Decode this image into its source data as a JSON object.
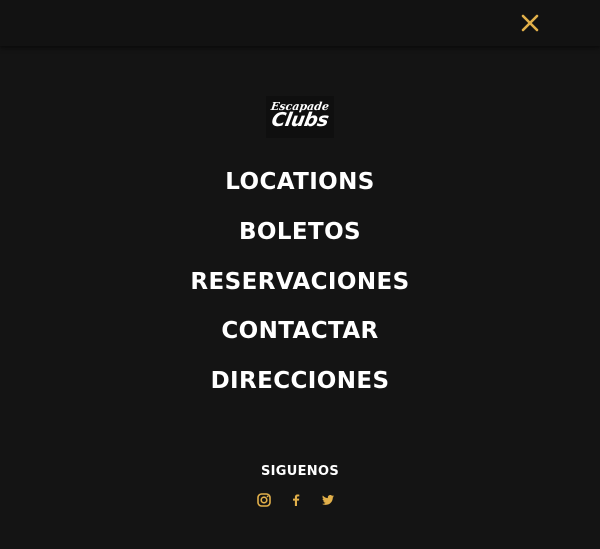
{
  "colors": {
    "background": "#141414",
    "topbar": "#121212",
    "accent": "#e2b04a",
    "text": "#ffffff"
  },
  "header": {
    "close_icon": "close-x-icon"
  },
  "logo": {
    "script_text": "Escapade",
    "brand_text": "Clubs"
  },
  "menu": {
    "items": [
      {
        "label": "LOCATIONS"
      },
      {
        "label": "BOLETOS"
      },
      {
        "label": "RESERVACIONES"
      },
      {
        "label": "CONTACTAR"
      },
      {
        "label": "DIRECCIONES"
      }
    ]
  },
  "social": {
    "title": "SIGUENOS",
    "icons": [
      "instagram-icon",
      "facebook-icon",
      "twitter-icon"
    ]
  }
}
